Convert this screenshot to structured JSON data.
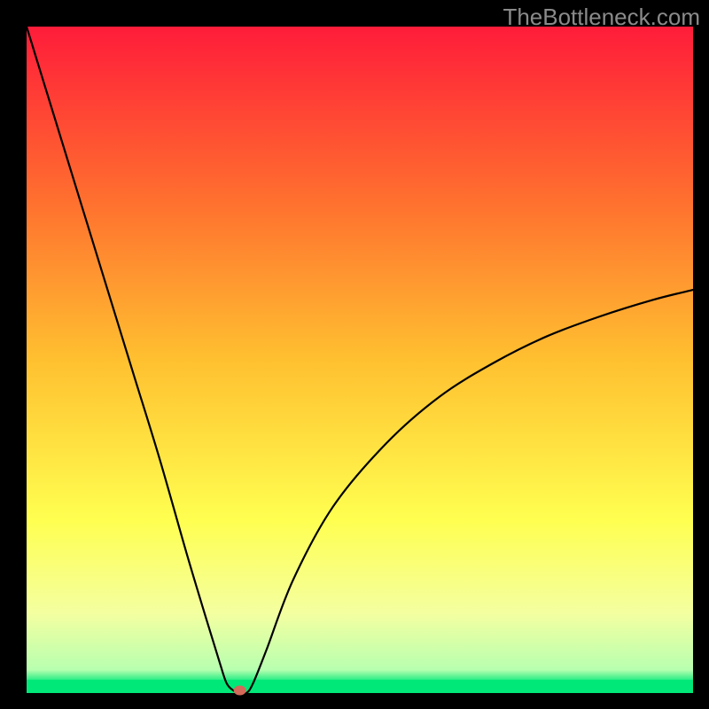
{
  "watermark": "TheBottleneck.com",
  "chart_data": {
    "type": "line",
    "title": "",
    "xlabel": "",
    "ylabel": "",
    "xlim": [
      0,
      100
    ],
    "ylim": [
      0,
      100
    ],
    "grid": false,
    "background": {
      "description": "Vertical gradient from red at top through orange and yellow with a thin pale-green band near the bottom and a narrow vivid-green strip at the very bottom",
      "stops": [
        {
          "offset": 0.0,
          "color": "#ff1c3a"
        },
        {
          "offset": 0.25,
          "color": "#ff6c2f"
        },
        {
          "offset": 0.5,
          "color": "#ffc030"
        },
        {
          "offset": 0.74,
          "color": "#ffff50"
        },
        {
          "offset": 0.88,
          "color": "#f4ffa0"
        },
        {
          "offset": 0.965,
          "color": "#b8ffb0"
        },
        {
          "offset": 0.985,
          "color": "#00e878"
        },
        {
          "offset": 1.0,
          "color": "#00e878"
        }
      ]
    },
    "annotations": [
      {
        "type": "point",
        "x": 32,
        "y": 0,
        "color": "#d46a5a",
        "label": "minimum-marker"
      }
    ],
    "series": [
      {
        "name": "bottleneck-curve",
        "description": "V-shaped curve: steep near-linear descent from the top-left corner down to a flat minimum at roughly x=32, then a concave rise leveling off toward the mid-right edge.",
        "x": [
          0,
          4,
          8,
          12,
          16,
          20,
          24,
          27,
          29,
          30,
          31,
          32,
          33,
          34,
          36,
          40,
          46,
          54,
          62,
          70,
          78,
          86,
          94,
          100
        ],
        "y": [
          100,
          87,
          74,
          61,
          48,
          35,
          21,
          11,
          4.5,
          1.5,
          0.4,
          0.0,
          0.0,
          1.5,
          6.5,
          17,
          28,
          37.5,
          44.5,
          49.5,
          53.5,
          56.5,
          59,
          60.5
        ]
      }
    ]
  }
}
